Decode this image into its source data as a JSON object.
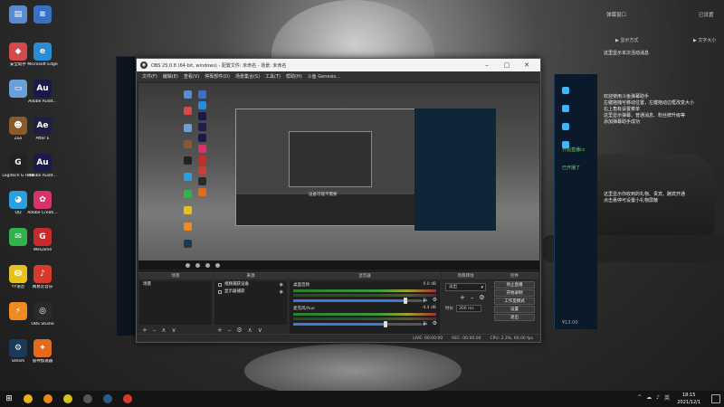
{
  "desktop": {
    "icons": [
      {
        "label": "",
        "color": "#5a8ccf",
        "glyph": "▤"
      },
      {
        "label": "",
        "color": "#3a6fc4",
        "glyph": "≋"
      },
      {
        "label": "安全助手",
        "color": "#d34a4a",
        "glyph": "◆"
      },
      {
        "label": "Microsoft Edge",
        "color": "#2b8cd6",
        "glyph": "e"
      },
      {
        "label": "",
        "color": "#6aa0d8",
        "glyph": "▭"
      },
      {
        "label": "Adobe Audit...",
        "color": "#1a1a4a",
        "glyph": "Au"
      },
      {
        "label": "Zoo",
        "color": "#8b5a2b",
        "glyph": "☻"
      },
      {
        "label": "After E",
        "color": "#1e1e46",
        "glyph": "Ae"
      },
      {
        "label": "Logitech G HUB",
        "color": "#222",
        "glyph": "G"
      },
      {
        "label": "Adobe Audit...",
        "color": "#1a1a4a",
        "glyph": "Au"
      },
      {
        "label": "QQ",
        "color": "#2aa0e0",
        "glyph": "◕"
      },
      {
        "label": "Adobe Creati...",
        "color": "#d6336c",
        "glyph": "✿"
      },
      {
        "label": "",
        "color": "#2fb34a",
        "glyph": "✉"
      },
      {
        "label": "WeGame",
        "color": "#c82b2b",
        "glyph": "G"
      },
      {
        "label": "YY语音",
        "color": "#e7c21c",
        "glyph": "Ꙫ"
      },
      {
        "label": "网易云音乐",
        "color": "#d6392e",
        "glyph": "♪"
      },
      {
        "label": "",
        "color": "#f08b1f",
        "glyph": "⚡"
      },
      {
        "label": "OBS Studio",
        "color": "#2a2a2a",
        "glyph": "◎"
      },
      {
        "label": "Steam",
        "color": "#1a3a5a",
        "glyph": "⚙"
      },
      {
        "label": "雷神加速器",
        "color": "#e36a1a",
        "glyph": "✦"
      }
    ]
  },
  "chat_panel": {
    "top_left": "弹幕窗口",
    "top_right": "已设置",
    "sub_left": "▶ 显示方式",
    "sub_right": "▶ 文字大小",
    "lines_a": [
      "这里显示本次活动消息"
    ],
    "lines_b": [
      "欢迎使用斗鱼弹幕助手",
      "左键拖拽可移动位置，左键拖动边框改变大小",
      "右上角有设置菜单",
      "这里显示弹幕、普通消息、粉丝牌升级等",
      "添加弹幕助手成功"
    ],
    "lines_c": [
      "这里显示你收到的礼物、贵宾、酬宾开通",
      "点击悬停可设置小礼物屏蔽"
    ],
    "inner_msgs": [
      "开始直播cc",
      "已开播了"
    ],
    "inner_foot": "¥13.00"
  },
  "obs": {
    "title": "OBS 25.0.8 (64-bit, windows) - 配置文件: 未命名 - 场景: 未命名",
    "menu": [
      "文件(F)",
      "编辑(E)",
      "查看(V)",
      "停靠部件(D)",
      "场景集合(S)",
      "工具(T)",
      "帮助(H)",
      "斗鱼 Genesis..."
    ],
    "preview_text": "设备可能不需要",
    "docks": {
      "scenes": {
        "title": "场景",
        "items": [
          "场景"
        ]
      },
      "sources": {
        "title": "来源",
        "items": [
          "视频捕获设备",
          "显示器捕获"
        ]
      },
      "mixer": {
        "title": "混音器",
        "channels": [
          {
            "name": "桌面音频",
            "db": "0.0 dB"
          },
          {
            "name": "麦克风/Aux",
            "db": "-4.4 dB"
          }
        ]
      },
      "transitions": {
        "title": "场景转场",
        "type": "淡出",
        "duration_label": "时长",
        "duration": "300 ms"
      },
      "controls": {
        "title": "控件",
        "buttons": [
          "停止直播",
          "开始录制",
          "工作室模式",
          "设置",
          "退出"
        ]
      }
    },
    "status": [
      "LIVE: 00:00:00",
      "REC: 00:00:00",
      "CPU: 2.3%, 60.00 fps"
    ]
  },
  "taskbar": {
    "time": "18:15",
    "date": "2021/12/1",
    "apps": [
      {
        "name": "chrome",
        "color": "#e8b21a"
      },
      {
        "name": "ghub",
        "color": "#e88a1a"
      },
      {
        "name": "app-l",
        "color": "#d6c21a"
      },
      {
        "name": "obs",
        "color": "#555"
      },
      {
        "name": "steam",
        "color": "#2a5a8a"
      },
      {
        "name": "netease",
        "color": "#d6392e"
      }
    ],
    "tray": [
      "^",
      "☁",
      "♪",
      "英"
    ]
  }
}
